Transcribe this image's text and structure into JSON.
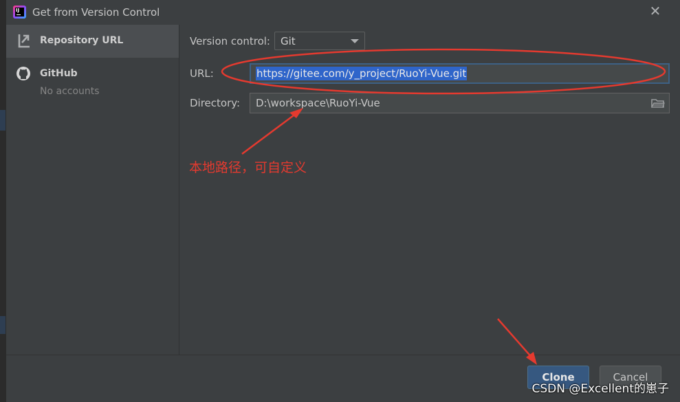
{
  "window": {
    "title": "Get from Version Control",
    "app_icon_text": "IJ",
    "close_icon": "close-icon"
  },
  "sidebar": {
    "items": [
      {
        "label": "Repository URL",
        "icon": "vcs-branch-icon",
        "selected": true
      },
      {
        "label": "GitHub",
        "sublabel": "No accounts",
        "icon": "github-icon",
        "selected": false
      }
    ]
  },
  "form": {
    "version_control": {
      "label": "Version control:",
      "value": "Git"
    },
    "url": {
      "label": "URL:",
      "value": "https://gitee.com/y_project/RuoYi-Vue.git"
    },
    "directory": {
      "label": "Directory:",
      "value": "D:\\workspace\\RuoYi-Vue",
      "browse_icon": "folder-icon"
    }
  },
  "annotation": {
    "text": "本地路径，可自定义",
    "color": "#e53a2f"
  },
  "buttons": {
    "clone": "Clone",
    "cancel": "Cancel"
  },
  "watermark": "CSDN @Excellent的崽子",
  "colors": {
    "dialog_bg": "#3c3f41",
    "selected_item_bg": "#4b4e51",
    "primary_button": "#365880",
    "selection": "#2f65ca",
    "focus_border": "#3d6185"
  }
}
